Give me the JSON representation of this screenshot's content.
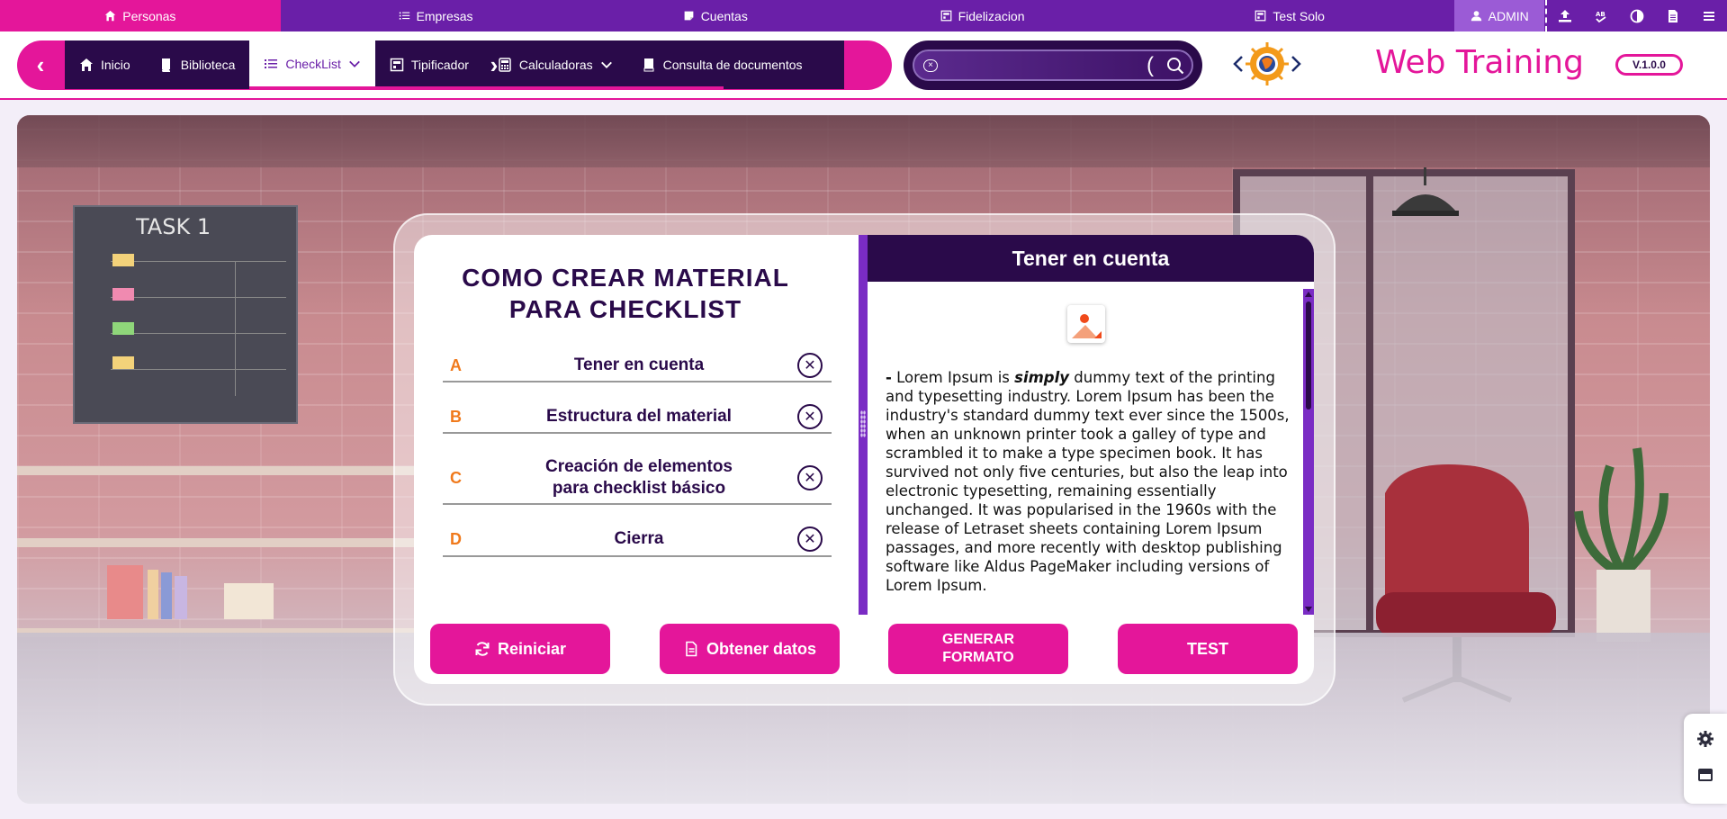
{
  "topbar": {
    "tabs": [
      {
        "label": "Personas",
        "icon": "home-icon",
        "active": true
      },
      {
        "label": "Empresas",
        "icon": "list-icon",
        "active": false
      },
      {
        "label": "Cuentas",
        "icon": "note-icon",
        "active": false
      },
      {
        "label": "Fidelizacion",
        "icon": "window-icon",
        "active": false
      },
      {
        "label": "Test Solo",
        "icon": "window-icon",
        "active": false
      }
    ],
    "admin_label": "ADMIN",
    "tools": [
      "upload-icon",
      "text-spelling-icon",
      "contrast-icon",
      "document-icon",
      "menu-icon"
    ]
  },
  "nav": {
    "items": [
      {
        "label": "Inicio",
        "icon": "home-icon"
      },
      {
        "label": "Biblioteca",
        "icon": "book-icon"
      },
      {
        "label": "CheckList",
        "icon": "list-icon",
        "active": true,
        "dropdown": true
      },
      {
        "label": "Tipificador",
        "icon": "window-icon"
      },
      {
        "label": "Calculadoras",
        "icon": "calculator-icon",
        "dropdown": true
      },
      {
        "label": "Consulta de documentos",
        "icon": "book-icon"
      }
    ]
  },
  "search": {
    "placeholder": "",
    "value": ""
  },
  "brand": {
    "title": "Web Training",
    "version": "V.1.0.0"
  },
  "checklist": {
    "heading_line1": "COMO CREAR MATERIAL",
    "heading_line2": "PARA CHECKLIST",
    "options": [
      {
        "letter": "A",
        "label": "Tener en cuenta"
      },
      {
        "letter": "B",
        "label": "Estructura del material"
      },
      {
        "letter": "C",
        "label_line1": "Creación de elementos",
        "label_line2": "para checklist básico"
      },
      {
        "letter": "D",
        "label": "Cierra"
      }
    ]
  },
  "panel": {
    "title": "Tener en cuenta",
    "dash": "-",
    "text_start": "Lorem Ipsum is",
    "text_emph": "simply",
    "text_rest": "dummy text of the printing and typesetting industry. Lorem Ipsum has been the industry's standard dummy text ever since the 1500s, when an unknown printer took a galley of type and scrambled it to make a type specimen book. It has survived not only five centuries, but also the leap into electronic typesetting, remaining essentially unchanged. It was popularised in the 1960s with the release of Letraset sheets containing Lorem Ipsum passages, and more recently with desktop publishing software like Aldus PageMaker including versions of Lorem Ipsum."
  },
  "buttons": {
    "reset": "Reiniciar",
    "get_data": "Obtener datos",
    "generate_line1": "GENERAR",
    "generate_line2": "FORMATO",
    "test": "TEST"
  },
  "scene": {
    "board_title": "TASK 1"
  },
  "colors": {
    "accent": "#e4169a",
    "primary": "#6a1fa8",
    "dark": "#2a0a4a",
    "letter": "#f07a1c"
  }
}
